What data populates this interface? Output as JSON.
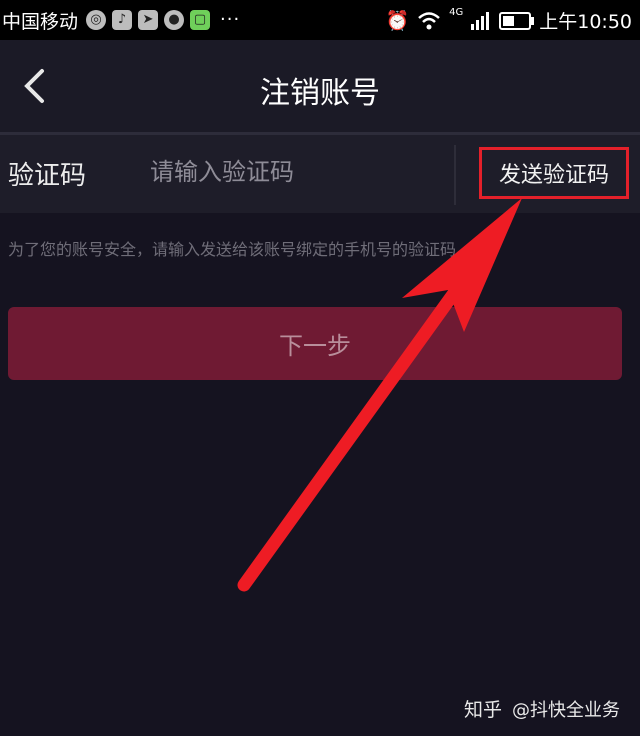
{
  "status_bar": {
    "carrier": "中国移动",
    "icons": [
      "message-icon",
      "tiktok-icon",
      "send-icon",
      "chat-icon",
      "app-icon"
    ],
    "more": "···",
    "network": "4G",
    "time": "上午10:50"
  },
  "header": {
    "title": "注销账号",
    "back_icon": "back-chevron-icon"
  },
  "verification": {
    "label": "验证码",
    "placeholder": "请输入验证码",
    "send_label": "发送验证码"
  },
  "hint": "为了您的账号安全，请输入发送给该账号绑定的手机号的验证码。",
  "next_button": "下一步",
  "watermark": {
    "logo": "知乎",
    "author": "@抖快全业务"
  },
  "colors": {
    "background": "#151320",
    "button": "#6f1a33",
    "highlight": "#e4202a"
  }
}
